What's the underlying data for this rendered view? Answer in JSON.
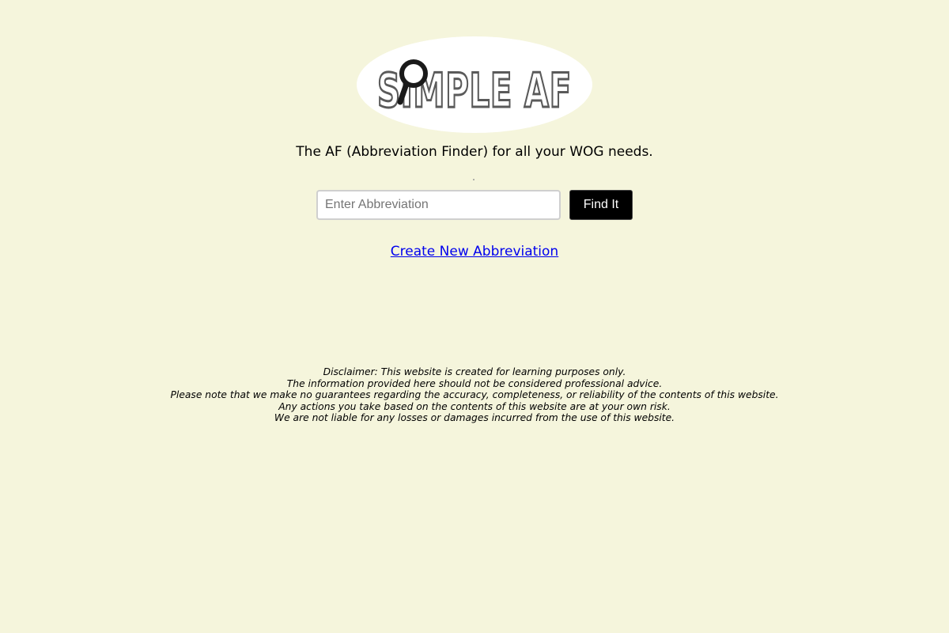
{
  "logo": {
    "text": "SIMPLE AF",
    "icon": "magnifier-icon"
  },
  "tagline": "The AF (Abbreviation Finder) for all your WOG needs.",
  "search": {
    "placeholder": "Enter Abbreviation",
    "value": "",
    "button_label": "Find It"
  },
  "create_link": "Create New Abbreviation",
  "disclaimer": [
    "Disclaimer: This website is created for learning purposes only.",
    "The information provided here should not be considered professional advice.",
    "Please note that we make no guarantees regarding the accuracy, completeness, or reliability of the contents of this website.",
    "Any actions you take based on the contents of this website are at your own risk.",
    "We are not liable for any losses or damages incurred from the use of this website."
  ],
  "colors": {
    "background": "#f5f5dc",
    "button": "#000000",
    "link": "#0000ee",
    "logo_stroke": "#5a5a5a"
  }
}
